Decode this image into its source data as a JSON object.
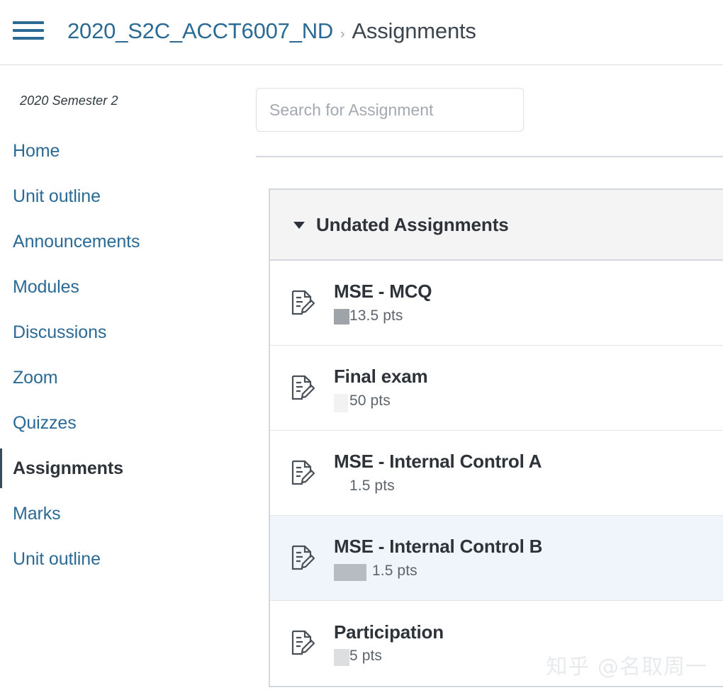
{
  "header": {
    "menu_icon": "hamburger-menu-icon",
    "breadcrumb": {
      "course": "2020_S2C_ACCT6007_ND",
      "separator": "›",
      "current": "Assignments"
    }
  },
  "sidebar": {
    "term_label": "2020 Semester 2",
    "items": [
      {
        "label": "Home",
        "active": false
      },
      {
        "label": "Unit outline",
        "active": false
      },
      {
        "label": "Announcements",
        "active": false
      },
      {
        "label": "Modules",
        "active": false
      },
      {
        "label": "Discussions",
        "active": false
      },
      {
        "label": "Zoom",
        "active": false
      },
      {
        "label": "Quizzes",
        "active": false
      },
      {
        "label": "Assignments",
        "active": true
      },
      {
        "label": "Marks",
        "active": false
      },
      {
        "label": "Unit outline",
        "active": false
      }
    ]
  },
  "main": {
    "search": {
      "placeholder": "Search for Assignment",
      "value": ""
    },
    "group": {
      "caret_icon": "chevron-down-icon",
      "title": "Undated Assignments",
      "expanded": true
    },
    "assignments": [
      {
        "icon": "assignment-document-pencil-icon",
        "title": "MSE - MCQ",
        "points": "13.5 pts",
        "redaction": "dark",
        "highlighted": false
      },
      {
        "icon": "assignment-document-pencil-icon",
        "title": "Final exam",
        "points": "50 pts",
        "redaction": "white",
        "highlighted": false
      },
      {
        "icon": "assignment-document-pencil-icon",
        "title": "MSE - Internal Control A",
        "points": "1.5 pts",
        "redaction": "none",
        "highlighted": false
      },
      {
        "icon": "assignment-document-pencil-icon",
        "title": "MSE - Internal Control B",
        "points": "1.5 pts",
        "redaction": "wide",
        "highlighted": true
      },
      {
        "icon": "assignment-document-pencil-icon",
        "title": "Participation",
        "points": "5 pts",
        "redaction": "light",
        "highlighted": false
      }
    ]
  },
  "watermark": {
    "text": "知乎 @名取周一"
  },
  "colors": {
    "link_blue": "#2b6a95",
    "text_dark": "#2d3338",
    "muted": "#5d646b",
    "row_highlight": "#eff5fb",
    "group_header_bg": "#f4f4f5",
    "border": "#d5d8dc"
  }
}
